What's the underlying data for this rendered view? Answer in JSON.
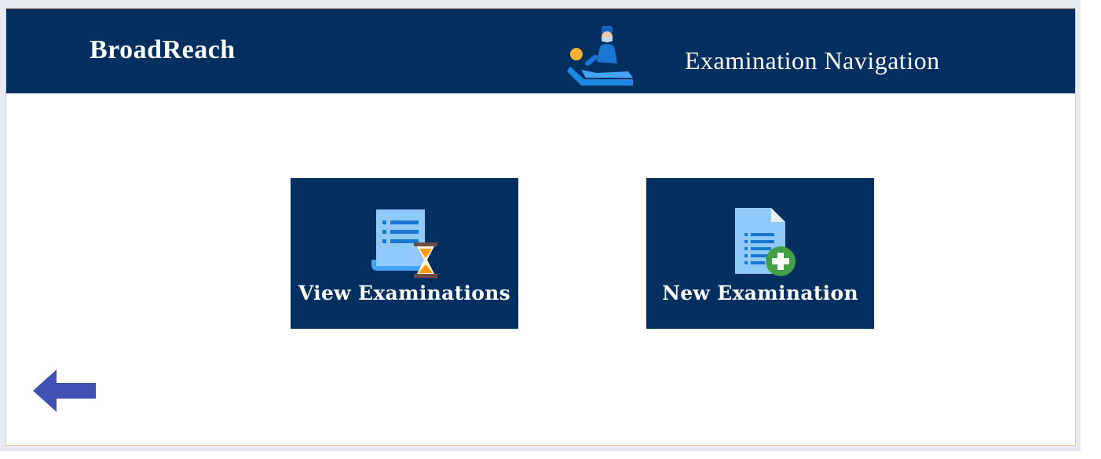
{
  "app": {
    "brand": "BroadReach",
    "page_title": "Examination Navigation"
  },
  "header": {
    "icon": "patient-examination-icon"
  },
  "tiles": [
    {
      "label": "View Examinations",
      "icon": "document-hourglass-icon"
    },
    {
      "label": "New Examination",
      "icon": "document-add-icon"
    }
  ],
  "navigation": {
    "back_icon": "back-arrow-icon"
  },
  "colors": {
    "header_bg": "#012f5f",
    "tile_bg": "#012f5f",
    "back_arrow": "#3f51b5",
    "frame_border": "#f2c48d"
  }
}
